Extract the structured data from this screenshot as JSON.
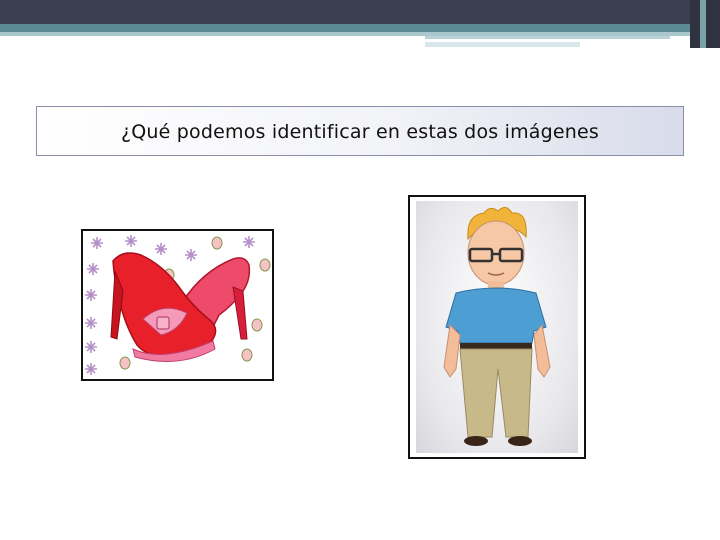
{
  "slide": {
    "title": "¿Qué podemos identificar en estas dos imágenes"
  },
  "images": {
    "shoes": "red-high-heel-shoes-illustration",
    "person": "cartoon-man-with-glasses"
  },
  "colors": {
    "top_bar": "#3b3f4f",
    "teal_bar": "#5a8a94",
    "title_border": "#8a8ea8",
    "shoe_red": "#e8202a",
    "shoe_pink": "#f07aa0",
    "shirt_blue": "#4c9ed3",
    "pants_khaki": "#c8b98a",
    "hair_blond": "#f0b43a"
  }
}
